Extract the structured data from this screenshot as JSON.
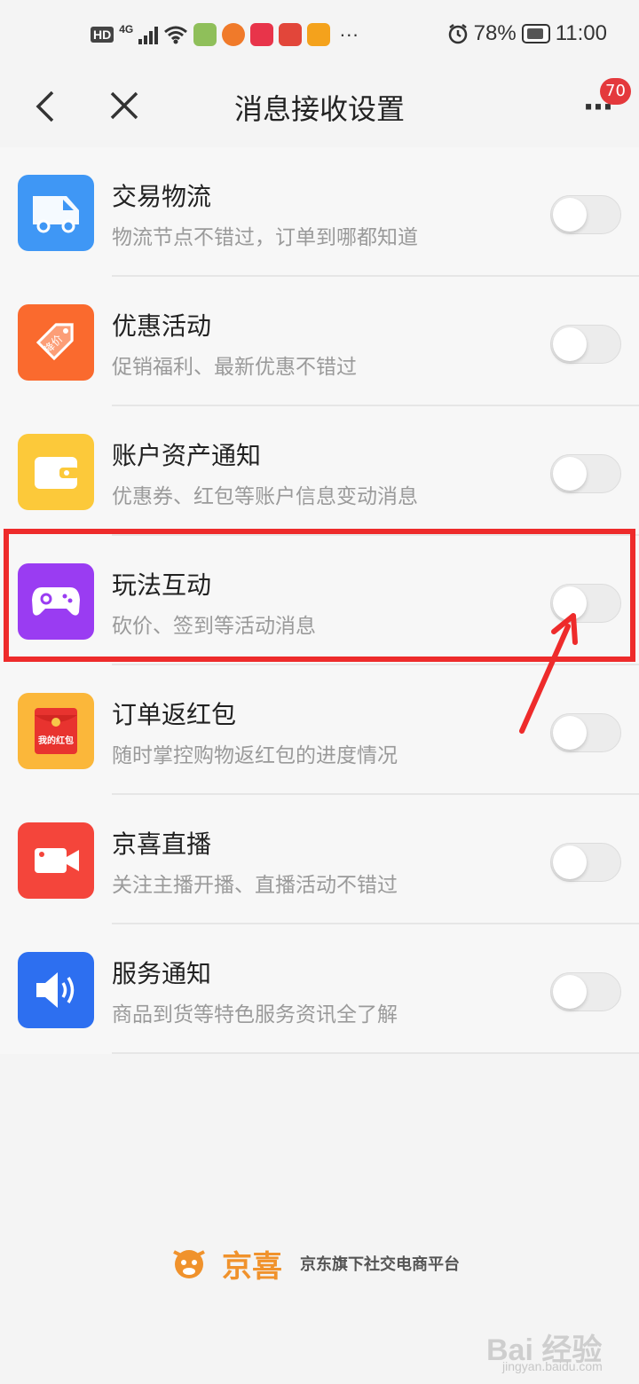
{
  "status_bar": {
    "network_hd": "HD",
    "network_type": "4G",
    "more": "···",
    "battery": "78%",
    "time": "11:00"
  },
  "nav": {
    "title": "消息接收设置",
    "more_glyph": "···",
    "badge": "70"
  },
  "items": [
    {
      "title": "交易物流",
      "subtitle": "物流节点不错过，订单到哪都知道",
      "enabled": false,
      "icon": "truck-icon",
      "color": "#3f97f5"
    },
    {
      "title": "优惠活动",
      "subtitle": "促销福利、最新优惠不错过",
      "enabled": false,
      "icon": "price-tag-icon",
      "icon_text": "降价",
      "color": "#fa6a2e"
    },
    {
      "title": "账户资产通知",
      "subtitle": "优惠券、红包等账户信息变动消息",
      "enabled": false,
      "icon": "wallet-icon",
      "color": "#fcc93a"
    },
    {
      "title": "玩法互动",
      "subtitle": "砍价、签到等活动消息",
      "enabled": false,
      "icon": "gamepad-icon",
      "color": "#9a3cf2"
    },
    {
      "title": "订单返红包",
      "subtitle": "随时掌控购物返红包的进度情况",
      "enabled": false,
      "icon": "red-envelope-icon",
      "icon_text": "我的红包",
      "color": "#fbb73a"
    },
    {
      "title": "京喜直播",
      "subtitle": "关注主播开播、直播活动不错过",
      "enabled": false,
      "icon": "video-camera-icon",
      "color": "#f4453b"
    },
    {
      "title": "服务通知",
      "subtitle": "商品到货等特色服务资讯全了解",
      "enabled": false,
      "icon": "speaker-icon",
      "color": "#2d6ff0"
    }
  ],
  "annotation": {
    "highlight_color": "#ee2b2b"
  },
  "footer": {
    "brand": "京喜",
    "slogan": "京东旗下社交电商平台"
  },
  "watermark": {
    "text": "Bai 经验",
    "sub": "jingyan.baidu.com"
  }
}
